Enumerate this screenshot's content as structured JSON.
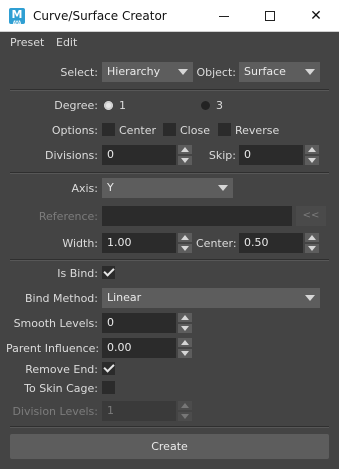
{
  "window": {
    "title": "Curve/Surface Creator",
    "icon_letter": "M",
    "icon_sub": "AYA"
  },
  "menu": [
    "Preset",
    "Edit"
  ],
  "select": {
    "label": "Select:",
    "value": "Hierarchy"
  },
  "object": {
    "label": "Object:",
    "value": "Surface"
  },
  "degree": {
    "label": "Degree:",
    "option1": "1",
    "option3": "3",
    "selected": "1"
  },
  "options": {
    "label": "Options:",
    "center": "Center",
    "close": "Close",
    "reverse": "Reverse"
  },
  "divisions": {
    "label": "Divisions:",
    "value": "0"
  },
  "skip": {
    "label": "Skip:",
    "value": "0"
  },
  "axis": {
    "label": "Axis:",
    "value": "Y"
  },
  "reference": {
    "label": "Reference:",
    "button": "<<"
  },
  "width": {
    "label": "Width:",
    "value": "1.00"
  },
  "center": {
    "label": "Center:",
    "value": "0.50"
  },
  "is_bind": {
    "label": "Is Bind:",
    "checked": true
  },
  "bind_method": {
    "label": "Bind Method:",
    "value": "Linear"
  },
  "smooth_levels": {
    "label": "Smooth Levels:",
    "value": "0"
  },
  "parent_influence": {
    "label": "Parent Influence:",
    "value": "0.00"
  },
  "remove_end": {
    "label": "Remove End:",
    "checked": true
  },
  "to_skin_cage": {
    "label": "To Skin Cage:",
    "checked": false
  },
  "division_levels": {
    "label": "Division Levels:",
    "value": "1"
  },
  "create_button": "Create"
}
